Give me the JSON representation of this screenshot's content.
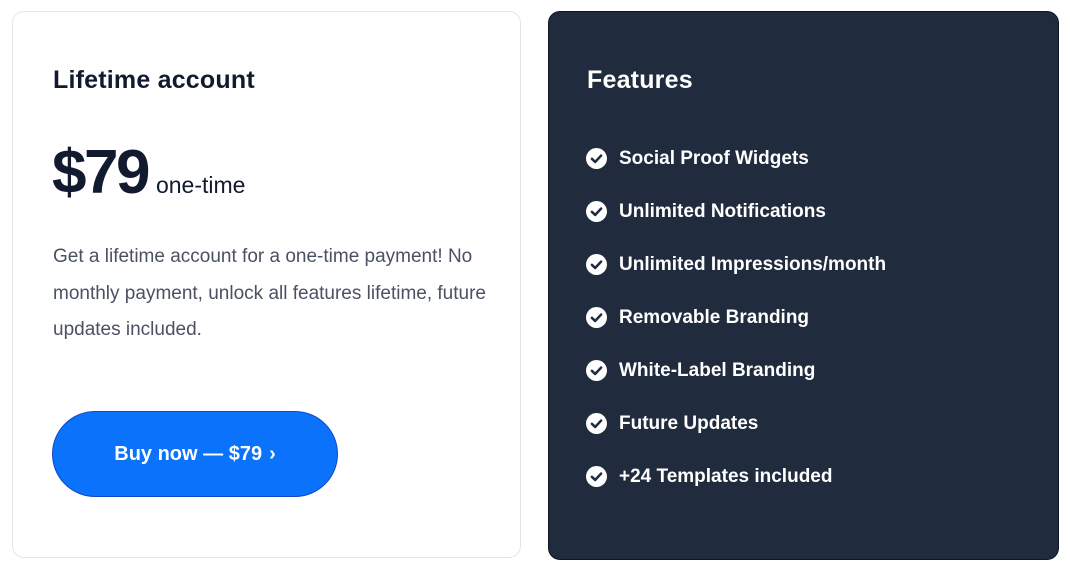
{
  "plan": {
    "title": "Lifetime account",
    "price": "$79",
    "period": "one-time",
    "description": "Get a lifetime account for a one-time payment! No monthly payment, unlock all features lifetime, future updates included.",
    "button_label": "Buy now — $79",
    "button_chevron": "›",
    "button_color": "#0a72fb"
  },
  "features": {
    "title": "Features",
    "background_color": "#202b3d",
    "icon": "check-circle-icon",
    "items": [
      "Social Proof Widgets",
      "Unlimited Notifications",
      "Unlimited Impressions/month",
      "Removable Branding",
      "White-Label Branding",
      "Future Updates",
      "+24 Templates included"
    ]
  }
}
